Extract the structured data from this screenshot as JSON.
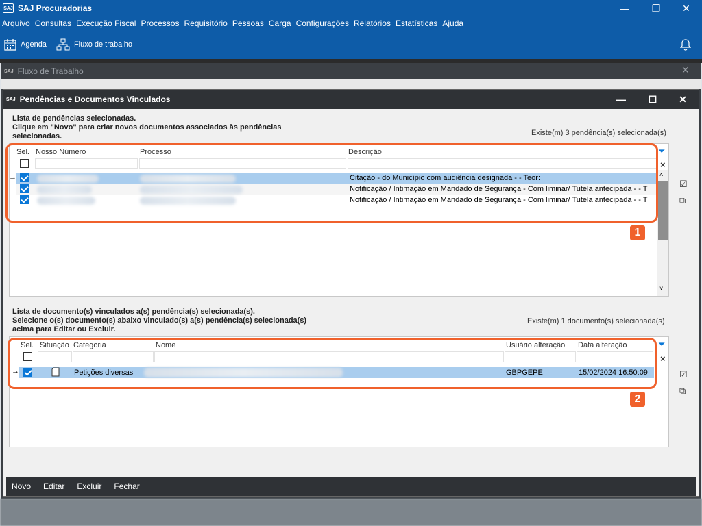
{
  "app": {
    "logo_text": "SAJ",
    "title": "SAJ Procuradorias",
    "menu": [
      "Arquivo",
      "Consultas",
      "Execução Fiscal",
      "Processos",
      "Requisitório",
      "Pessoas",
      "Carga",
      "Configurações",
      "Relatórios",
      "Estatísticas",
      "Ajuda"
    ],
    "toolbar": {
      "agenda": "Agenda",
      "fluxo": "Fluxo de trabalho"
    },
    "controls": {
      "minimize": "—",
      "restore": "❐",
      "close": "✕"
    }
  },
  "workflow_window": {
    "title": "Fluxo de Trabalho"
  },
  "dialog": {
    "title": "Pendências e Documentos Vinculados",
    "section1": {
      "line1": "Lista de pendências selecionadas.",
      "line2": "Clique em \"Novo\" para criar novos documentos associados às pendências",
      "line3": "selecionadas.",
      "count": "Existe(m) 3 pendência(s) selecionada(s)",
      "columns": {
        "sel": "Sel.",
        "nosso": "Nosso Número",
        "processo": "Processo",
        "descricao": "Descrição"
      },
      "rows": [
        {
          "descricao": "Citação - do Município com audiência designada -  - Teor:"
        },
        {
          "descricao": "Notificação / Intimação em Mandado de Segurança - Com liminar/ Tutela antecipada -  - T"
        },
        {
          "descricao": "Notificação / Intimação em Mandado de Segurança - Com liminar/ Tutela antecipada -  - T"
        }
      ],
      "badge": "1"
    },
    "section2": {
      "line1": "Lista de documento(s) vinculados a(s) pendência(s) selecionada(s).",
      "line2": "Selecione o(s) documento(s) abaixo vinculado(s) a(s) pendência(s) selecionada(s)",
      "line3": "acima para Editar ou Excluir.",
      "count": "Existe(m) 1 documento(s) selecionada(s)",
      "columns": {
        "sel": "Sel.",
        "situacao": "Situação",
        "categoria": "Categoria",
        "nome": "Nome",
        "usuario": "Usuário alteração",
        "data": "Data alteração"
      },
      "rows": [
        {
          "categoria": "Petições diversas",
          "usuario": "GBPGEPE",
          "data": "15/02/2024 16:50:09"
        }
      ],
      "badge": "2"
    },
    "buttons": {
      "novo": "Novo",
      "editar": "Editar",
      "excluir": "Excluir",
      "fechar": "Fechar"
    }
  },
  "colors": {
    "accent": "#0e5ca8",
    "callout": "#f0612c",
    "selection": "#a9cdee"
  }
}
